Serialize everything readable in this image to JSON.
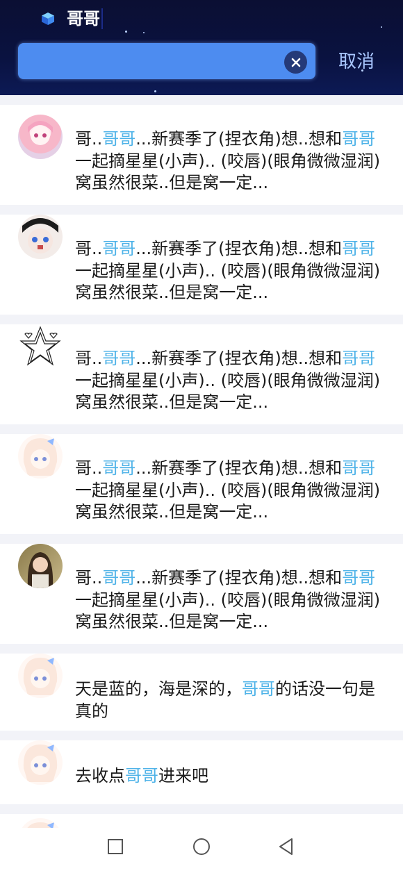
{
  "search": {
    "query": "哥哥",
    "cancel_label": "取消"
  },
  "icons": {
    "search_prefix": "cube-icon",
    "clear": "close-circle-icon",
    "nav": [
      "recent-apps-icon",
      "home-icon",
      "back-icon"
    ]
  },
  "colors": {
    "highlight": "#4fb3e8",
    "search_box": "#4d8cf0",
    "header_bg": "#0b0f33"
  },
  "results": [
    {
      "pre": " 哥..",
      "hl1": "哥哥",
      "mid": "...新赛季了(捏衣角)想..想和",
      "hl2": "哥哥",
      "post": "一起摘星星(小声).. (咬唇)(眼角微微湿润)窝虽然很菜..但是窝一定..."
    },
    {
      "pre": " 哥..",
      "hl1": "哥哥",
      "mid": "...新赛季了(捏衣角)想..想和",
      "hl2": "哥哥",
      "post": "一起摘星星(小声).. (咬唇)(眼角微微湿润)窝虽然很菜..但是窝一定..."
    },
    {
      "pre": " 哥..",
      "hl1": "哥哥",
      "mid": "...新赛季了(捏衣角)想..想和",
      "hl2": "哥哥",
      "post": "一起摘星星(小声).. (咬唇)(眼角微微湿润)窝虽然很菜..但是窝一定..."
    },
    {
      "pre": " 哥..",
      "hl1": "哥哥",
      "mid": "...新赛季了(捏衣角)想..想和",
      "hl2": "哥哥",
      "post": "一起摘星星(小声).. (咬唇)(眼角微微湿润)窝虽然很菜..但是窝一定..."
    },
    {
      "pre": " 哥..",
      "hl1": "哥哥",
      "mid": "...新赛季了(捏衣角)想..想和",
      "hl2": "哥哥",
      "post": "一起摘星星(小声).. (咬唇)(眼角微微湿润)窝虽然很菜..但是窝一定..."
    },
    {
      "pre": "天是蓝的，海是深的，",
      "hl1": "哥哥",
      "mid": "的话没一句是真的",
      "hl2": "",
      "post": ""
    },
    {
      "pre": "去收点",
      "hl1": "哥哥",
      "mid": "进来吧",
      "hl2": "",
      "post": ""
    }
  ]
}
